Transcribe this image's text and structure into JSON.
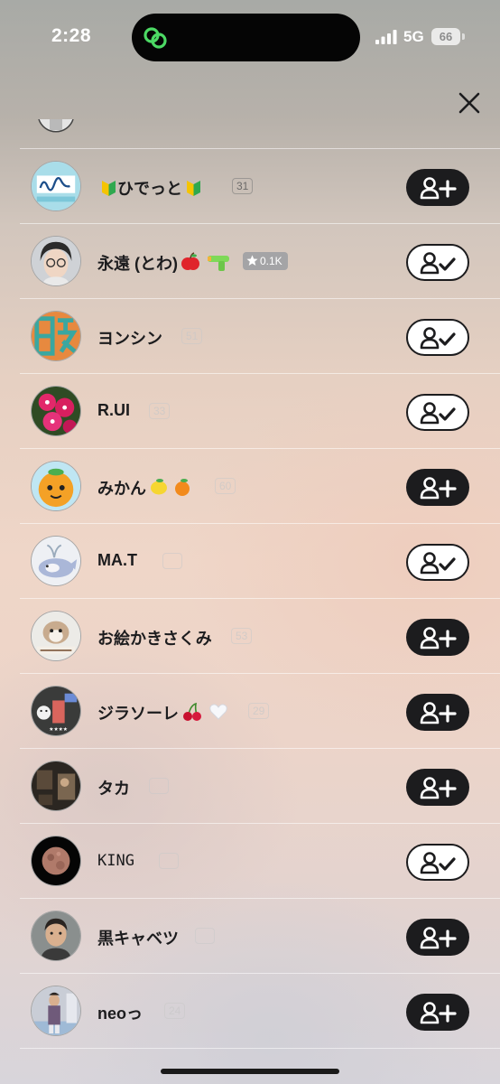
{
  "status_bar": {
    "time": "2:28",
    "network": "5G",
    "battery": "66"
  },
  "users": [
    {
      "name": "ひでっと",
      "badge": "31",
      "following": false
    },
    {
      "name": "永遠 (とわ)",
      "badge": "0.1K",
      "following": true
    },
    {
      "name": "ヨンシン",
      "badge": "51",
      "following": true
    },
    {
      "name": "R.UI",
      "badge": "33",
      "following": true
    },
    {
      "name": "みかん",
      "badge": "60",
      "following": false
    },
    {
      "name": "MA.T",
      "badge": "",
      "following": true
    },
    {
      "name": "お絵かきさくみ",
      "badge": "53",
      "following": false
    },
    {
      "name": "ジラソーレ",
      "badge": "29",
      "following": false
    },
    {
      "name": "タカ",
      "badge": "",
      "following": false
    },
    {
      "name": "KING",
      "badge": "",
      "following": true
    },
    {
      "name": "黒キャベツ",
      "badge": "",
      "following": false
    },
    {
      "name": "neoっ",
      "badge": "24",
      "following": false
    }
  ],
  "colors": {
    "button_dark": "#1c1c1e",
    "button_light": "#ffffff",
    "island_icon": "#4cd964"
  },
  "icons": {
    "close": "close-icon",
    "follow": "add-person-icon",
    "following": "person-check-icon"
  }
}
